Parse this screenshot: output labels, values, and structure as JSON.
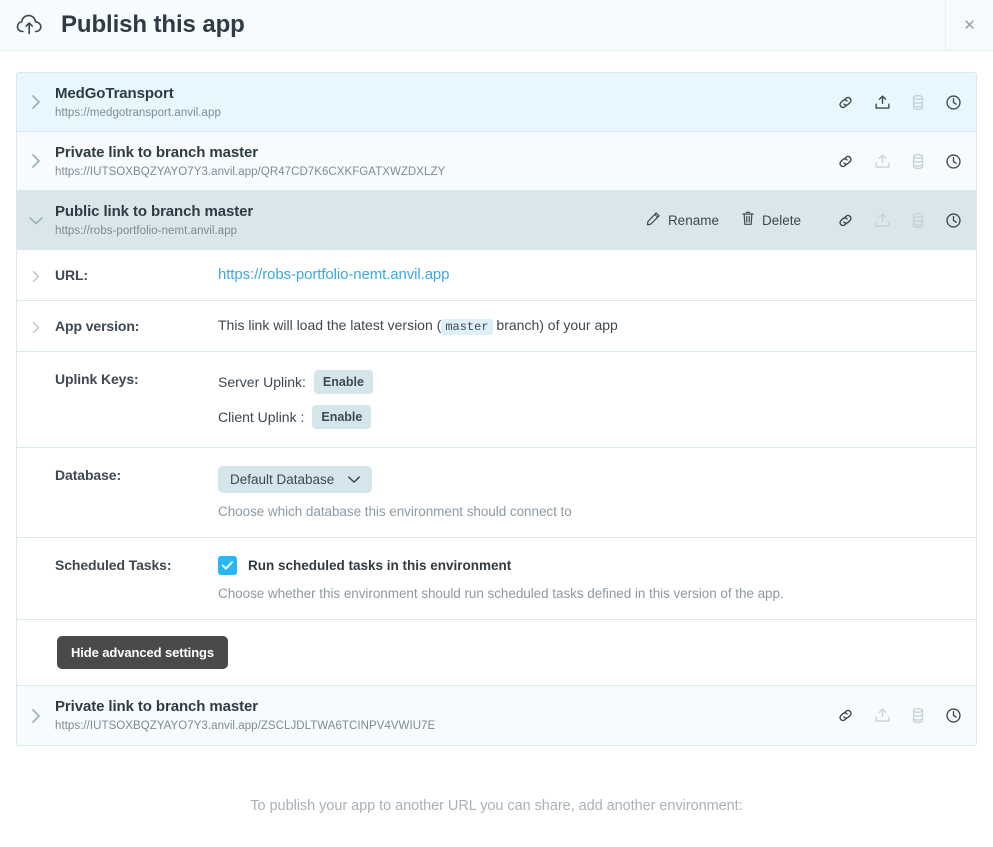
{
  "header": {
    "icon": "cloud-upload-icon",
    "title": "Publish this app",
    "close_label": "✕"
  },
  "environments": [
    {
      "chevron": "chevron-right-icon",
      "name": "MedGoTransport",
      "url": "https://medgotransport.anvil.app",
      "expanded": false,
      "tint": "tint-a",
      "publish_enabled": true
    },
    {
      "chevron": "chevron-right-icon",
      "name": "Private link to branch master",
      "url": "https://IUTSOXBQZYAYO7Y3.anvil.app/QR47CD7K6CXKFGATXWZDXLZY",
      "expanded": false,
      "tint": "tint-b",
      "publish_enabled": false
    },
    {
      "chevron": "chevron-down-icon",
      "name": "Public link to branch master",
      "url": "https://robs-portfolio-nemt.anvil.app",
      "expanded": true,
      "tint": "tint-c",
      "publish_enabled": false,
      "rename_label": "Rename",
      "delete_label": "Delete"
    },
    {
      "chevron": "chevron-right-icon",
      "name": "Private link to branch master",
      "url": "https://IUTSOXBQZYAYO7Y3.anvil.app/ZSCLJDLTWA6TCINPV4VWIU7E",
      "expanded": false,
      "tint": "tint-b",
      "publish_enabled": false
    }
  ],
  "details": {
    "url": {
      "label": "URL:",
      "value": "https://robs-portfolio-nemt.anvil.app"
    },
    "app_version": {
      "label": "App version:",
      "text_before": "This link will load the latest version (",
      "branch": "master",
      "text_after": "branch) of your app"
    },
    "uplink": {
      "label": "Uplink Keys:",
      "server_label": "Server Uplink:",
      "server_button": "Enable",
      "client_label": "Client Uplink :",
      "client_button": "Enable"
    },
    "database": {
      "label": "Database:",
      "selected": "Default Database",
      "helper": "Choose which database this environment should connect to"
    },
    "scheduled_tasks": {
      "label": "Scheduled Tasks:",
      "checkbox_label": "Run scheduled tasks in this environment",
      "checked": true,
      "helper": "Choose whether this environment should run scheduled tasks defined in this version of the app."
    },
    "advanced_button": "Hide advanced settings"
  },
  "footer": {
    "note": "To publish your app to another URL you can share, add another environment:"
  },
  "colors": {
    "link": "#3aa9e8",
    "checkbox": "#29b6f6",
    "chip": "#d4e6ec",
    "row_active": "#d9e6ea",
    "row_highlight": "#e8f7fd",
    "dark_button": "#4a4a4a"
  }
}
